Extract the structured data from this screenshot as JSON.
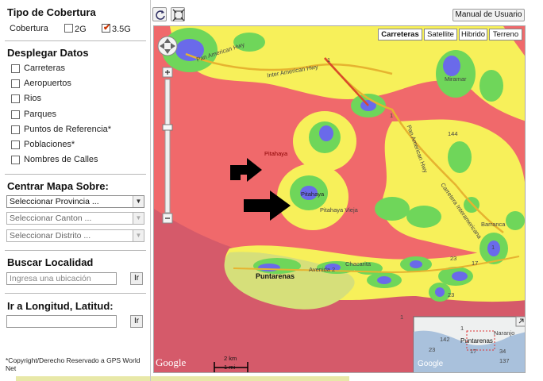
{
  "sidebar": {
    "coverage_title": "Tipo de Cobertura",
    "coverage_label": "Cobertura",
    "opt_2g": "2G",
    "opt_35g": "3.5G",
    "display_title": "Desplegar Datos",
    "layers": [
      "Carreteras",
      "Aeropuertos",
      "Rios",
      "Parques",
      "Puntos de Referencia*",
      "Poblaciones*",
      "Nombres de Calles"
    ],
    "center_title": "Centrar Mapa Sobre:",
    "select_province": "Seleccionar Provincia ...",
    "select_canton": "Seleccionar Canton ...",
    "select_district": "Seleccionar Distrito ...",
    "search_title": "Buscar Localidad",
    "search_placeholder": "Ingresa una ubicación",
    "search_go": "Ir",
    "coords_title": "Ir a Longitud, Latitud:",
    "coords_go": "Ir",
    "copyright": "*Copyright/Derecho Reservado a GPS World Net"
  },
  "toolbar": {
    "manual_label": "Manual de Usuario"
  },
  "map": {
    "types": [
      "Carreteras",
      "Satellite",
      "Hibrido",
      "Terreno"
    ],
    "active_type": "Carreteras",
    "google_logo": "Google",
    "google_logo_mini": "Google",
    "scale_km": "2 km",
    "scale_mi": "1 mi",
    "places": {
      "pitahaya_1": "Pitahaya",
      "pitahaya_2": "Pitahaya",
      "pitahaya_vieja": "Pitahaya Vieja",
      "miramar": "Miramar",
      "barranca": "Barranca",
      "chacarita": "Chacarita",
      "puntarenas": "Puntarenas",
      "avenida": "Avenida 2",
      "pan_american_1": "Pan American Hwy",
      "pan_american_2": "Pan American Hwy",
      "inter_american": "Inter American Hwy",
      "carretera_inter": "Carretera Interamericana",
      "route_1a": "1",
      "route_1b": "1",
      "route_1c": "1",
      "route_144": "144",
      "route_17": "17",
      "route_23": "23",
      "route_23b": "23",
      "route_1d": "1"
    },
    "overview": {
      "naranjo": "Naranjo",
      "puntarenas": "Puntarenas",
      "route_1": "1",
      "route_17": "17",
      "route_23": "23",
      "route_34": "34",
      "route_137": "137",
      "route_142": "142"
    },
    "colors": {
      "weak": "#f0696b",
      "medium": "#f7f05a",
      "good": "#6fd65a",
      "strong": "#6a6aea",
      "sea": "#d55a6a"
    }
  }
}
